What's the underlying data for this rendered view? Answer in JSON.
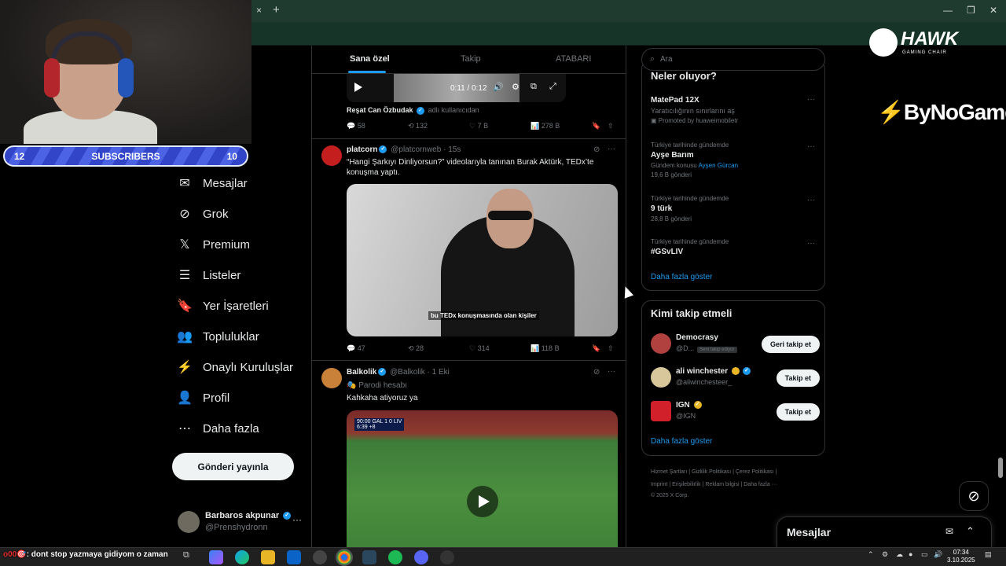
{
  "browser": {
    "tab_close": "×",
    "tab_new": "+",
    "win_min": "—",
    "win_max": "❐",
    "win_close": "✕"
  },
  "stream": {
    "subscribers_left": "12",
    "subscribers_label": "SUBSCRIBERS",
    "subscribers_right": "10",
    "chat_user": "ᴏ00🎯",
    "chat_message": ": dont stop yazmaya gidiyom o zaman"
  },
  "brands": {
    "hawk": "HAWK",
    "hawk_sub": "GAMING CHAIR",
    "bynogame": "ByNoGame"
  },
  "nav": {
    "items": [
      {
        "label": "Mesajlar",
        "icon": "✉"
      },
      {
        "label": "Grok",
        "icon": "⊘"
      },
      {
        "label": "Premium",
        "icon": "𝕏"
      },
      {
        "label": "Listeler",
        "icon": "☰"
      },
      {
        "label": "Yer İşaretleri",
        "icon": "🔖"
      },
      {
        "label": "Topluluklar",
        "icon": "👥"
      },
      {
        "label": "Onaylı Kuruluşlar",
        "icon": "⚡"
      },
      {
        "label": "Profil",
        "icon": "👤"
      },
      {
        "label": "Daha fazla",
        "icon": "⋯"
      }
    ],
    "post_button": "Gönderi yayınla",
    "account": {
      "name": "Barbaros akpunar",
      "handle": "@Prenshydronn",
      "more": "···"
    }
  },
  "feed": {
    "tabs": [
      "Sana özel",
      "Takip",
      "ATABARI"
    ],
    "video": {
      "time": "0:11 / 0:12"
    },
    "tweet0": {
      "meta_name": "Reşat Can Özbudak",
      "meta_suffix": "adlı kullanıcıdan",
      "replies": "58",
      "retweets": "132",
      "likes": "7 B",
      "views": "278 B"
    },
    "tweet1": {
      "name": "platcorn",
      "handle": "@platcornweb · 15s",
      "text": "“Hangi Şarkıyı Dinliyorsun?” videolarıyla tanınan Burak Aktürk, TEDx’te konuşma yaptı.",
      "caption": "bu TEDx konuşmasında olan kişiler",
      "replies": "47",
      "retweets": "28",
      "likes": "314",
      "views": "118 B"
    },
    "tweet2": {
      "name": "Balkolik",
      "handle": "@Balkolik · 1 Eki",
      "parody": "Parodi hesabı",
      "text": "Kahkaha atiyoruz ya",
      "score": "90:00  GAL 1 0 LIV",
      "score_sub": "6:39 +8"
    }
  },
  "right": {
    "search_placeholder": "Ara",
    "trends_header": "Neler oluyor?",
    "promo": {
      "title": "MatePad 12X",
      "sub": "Yaratıcılığının sınırlarını aş",
      "promoted": "Promoted by huaweimobiletr"
    },
    "trends": [
      {
        "ctx": "Türkiye tarihinde gündemde",
        "title": "Ayşe Barım",
        "sub_pre": "Gündem konusu",
        "sub_link": "Ayşen Gürcan",
        "posts": "19,6 B gönderi"
      },
      {
        "ctx": "Türkiye tarihinde gündemde",
        "title": "9 türk",
        "posts": "28,8 B gönderi"
      },
      {
        "ctx": "Türkiye tarihinde gündemde",
        "title": "#GSvLIV"
      }
    ],
    "show_more": "Daha fazla göster",
    "who_to_follow": "Kimi takip etmeli",
    "follows": [
      {
        "name": "Democrasy",
        "handle": "@D...",
        "badge": "Seni takip ediyor",
        "button": "Geri takip et"
      },
      {
        "name": "ali winchester",
        "handle": "@aliwinchesteer_",
        "button": "Takip et"
      },
      {
        "name": "IGN",
        "handle": "@IGN",
        "button": "Takip et"
      }
    ],
    "show_more2": "Daha fazla göster",
    "footer": {
      "line1": "Hizmet Şartları  |  Gizlilik Politikası  |  Çerez Politikası  |",
      "line2": "Imprint  |  Erişilebilirlik  |  Reklam bilgisi  |  Daha fazla ···",
      "line3": "© 2025 X Corp."
    }
  },
  "drawer": {
    "title": "Mesajlar"
  },
  "taskbar": {
    "time": "07:34",
    "date": "3.10.2025"
  },
  "colors": {
    "accent": "#1d9bf0",
    "chrome": "#1f3b30",
    "subbar": "#3245c8"
  }
}
